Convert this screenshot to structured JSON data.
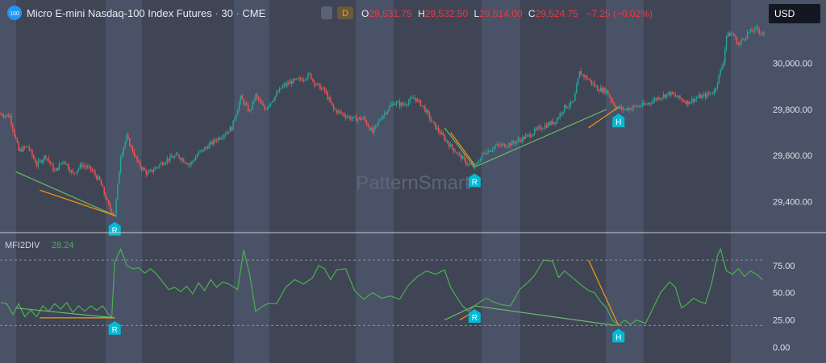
{
  "header": {
    "logo_text": "100",
    "symbol_title": "Micro E-mini Nasdaq-100 Index Futures",
    "interval": "30",
    "exchange": "CME",
    "d_badge": "D",
    "ohlc": [
      {
        "label": "O",
        "value": "29,531.75"
      },
      {
        "label": "H",
        "value": "29,532.50"
      },
      {
        "label": "L",
        "value": "29,514.00"
      },
      {
        "label": "C",
        "value": "29,524.75"
      }
    ],
    "change": "−7.25 (−0.02%)",
    "currency": "USD"
  },
  "watermark": "PatternSmart",
  "colors": {
    "up": "#26a69a",
    "down": "#ef5350",
    "indicator": "#4caf50",
    "divergence_orange": "#ff9800",
    "divergence_green": "#66bb6a",
    "marker": "#00bcd4",
    "background": "#495266",
    "session_shade": "#3f4555",
    "red_text": "#f23645",
    "indicator_value": "#4caf50"
  },
  "indicator": {
    "name": "MFI2DIV",
    "value": "28.24",
    "ticks": [
      "75.00",
      "50.00",
      "25.00",
      "0.00"
    ]
  },
  "chart_data": [
    {
      "type": "candlestick",
      "title": "Micro E-mini Nasdaq-100 Index Futures · 30 · CME",
      "y_ticks": [
        29400,
        29600,
        29800,
        30000
      ],
      "y_tick_labels": [
        "29,400.00",
        "29,600.00",
        "29,800.00",
        "30,000.00"
      ],
      "ylim": [
        29290,
        30170
      ],
      "close_path": [
        [
          0,
          29780
        ],
        [
          6,
          29770
        ],
        [
          12,
          29620
        ],
        [
          18,
          29640
        ],
        [
          24,
          29560
        ],
        [
          30,
          29600
        ],
        [
          36,
          29530
        ],
        [
          42,
          29580
        ],
        [
          48,
          29520
        ],
        [
          54,
          29560
        ],
        [
          60,
          29540
        ],
        [
          66,
          29490
        ],
        [
          72,
          29380
        ],
        [
          76,
          29340
        ],
        [
          80,
          29600
        ],
        [
          84,
          29680
        ],
        [
          88,
          29620
        ],
        [
          92,
          29560
        ],
        [
          98,
          29520
        ],
        [
          104,
          29550
        ],
        [
          110,
          29580
        ],
        [
          118,
          29600
        ],
        [
          126,
          29560
        ],
        [
          132,
          29610
        ],
        [
          140,
          29650
        ],
        [
          148,
          29690
        ],
        [
          154,
          29720
        ],
        [
          160,
          29850
        ],
        [
          166,
          29790
        ],
        [
          170,
          29860
        ],
        [
          176,
          29800
        ],
        [
          182,
          29850
        ],
        [
          188,
          29900
        ],
        [
          194,
          29920
        ],
        [
          200,
          29930
        ],
        [
          206,
          29950
        ],
        [
          210,
          29910
        ],
        [
          216,
          29880
        ],
        [
          222,
          29800
        ],
        [
          228,
          29780
        ],
        [
          234,
          29760
        ],
        [
          242,
          29760
        ],
        [
          248,
          29700
        ],
        [
          254,
          29770
        ],
        [
          262,
          29830
        ],
        [
          268,
          29820
        ],
        [
          276,
          29850
        ],
        [
          282,
          29810
        ],
        [
          288,
          29740
        ],
        [
          294,
          29690
        ],
        [
          300,
          29640
        ],
        [
          306,
          29600
        ],
        [
          312,
          29560
        ],
        [
          316,
          29550
        ],
        [
          322,
          29610
        ],
        [
          330,
          29640
        ],
        [
          340,
          29650
        ],
        [
          350,
          29680
        ],
        [
          360,
          29720
        ],
        [
          370,
          29750
        ],
        [
          376,
          29810
        ],
        [
          382,
          29830
        ],
        [
          386,
          29960
        ],
        [
          392,
          29930
        ],
        [
          398,
          29890
        ],
        [
          404,
          29880
        ],
        [
          410,
          29810
        ],
        [
          416,
          29800
        ],
        [
          422,
          29810
        ],
        [
          430,
          29820
        ],
        [
          438,
          29850
        ],
        [
          446,
          29870
        ],
        [
          452,
          29850
        ],
        [
          458,
          29830
        ],
        [
          464,
          29850
        ],
        [
          470,
          29860
        ],
        [
          476,
          29880
        ],
        [
          482,
          30010
        ],
        [
          484,
          30120
        ],
        [
          488,
          30130
        ],
        [
          492,
          30080
        ],
        [
          498,
          30130
        ],
        [
          504,
          30150
        ],
        [
          508,
          30130
        ]
      ],
      "annotations": [
        {
          "label": "R",
          "x_index": 76,
          "value": 29340
        },
        {
          "label": "R",
          "x_index": 316,
          "value": 29550
        },
        {
          "label": "H",
          "x_index": 412,
          "value": 29810
        }
      ]
    },
    {
      "type": "line",
      "series": [
        {
          "name": "MFI2DIV",
          "values": [
            [
              0,
              41
            ],
            [
              4,
              40
            ],
            [
              8,
              30
            ],
            [
              12,
              40
            ],
            [
              16,
              28
            ],
            [
              20,
              34
            ],
            [
              24,
              28
            ],
            [
              28,
              38
            ],
            [
              32,
              33
            ],
            [
              36,
              40
            ],
            [
              40,
              35
            ],
            [
              44,
              41
            ],
            [
              48,
              32
            ],
            [
              52,
              38
            ],
            [
              56,
              33
            ],
            [
              60,
              38
            ],
            [
              64,
              34
            ],
            [
              68,
              38
            ],
            [
              72,
              30
            ],
            [
              74,
              27
            ],
            [
              76,
              78
            ],
            [
              80,
              90
            ],
            [
              84,
              75
            ],
            [
              88,
              72
            ],
            [
              92,
              73
            ],
            [
              96,
              68
            ],
            [
              100,
              72
            ],
            [
              104,
              67
            ],
            [
              108,
              60
            ],
            [
              112,
              53
            ],
            [
              116,
              55
            ],
            [
              120,
              51
            ],
            [
              124,
              56
            ],
            [
              128,
              49
            ],
            [
              132,
              59
            ],
            [
              136,
              52
            ],
            [
              140,
              62
            ],
            [
              144,
              55
            ],
            [
              148,
              60
            ],
            [
              152,
              58
            ],
            [
              158,
              53
            ],
            [
              162,
              89
            ],
            [
              166,
              67
            ],
            [
              170,
              33
            ],
            [
              174,
              37
            ],
            [
              178,
              40
            ],
            [
              184,
              40
            ],
            [
              190,
              55
            ],
            [
              196,
              62
            ],
            [
              202,
              58
            ],
            [
              208,
              64
            ],
            [
              212,
              75
            ],
            [
              216,
              72
            ],
            [
              220,
              62
            ],
            [
              224,
              71
            ],
            [
              230,
              72
            ],
            [
              236,
              52
            ],
            [
              242,
              44
            ],
            [
              248,
              50
            ],
            [
              254,
              45
            ],
            [
              260,
              47
            ],
            [
              266,
              44
            ],
            [
              272,
              57
            ],
            [
              278,
              65
            ],
            [
              284,
              70
            ],
            [
              290,
              67
            ],
            [
              296,
              71
            ],
            [
              300,
              55
            ],
            [
              304,
              46
            ],
            [
              308,
              38
            ],
            [
              312,
              33
            ],
            [
              316,
              38
            ],
            [
              320,
              42
            ],
            [
              324,
              45
            ],
            [
              328,
              42
            ],
            [
              334,
              39
            ],
            [
              340,
              38
            ],
            [
              346,
              53
            ],
            [
              352,
              60
            ],
            [
              356,
              66
            ],
            [
              362,
              80
            ],
            [
              368,
              79
            ],
            [
              372,
              64
            ],
            [
              376,
              70
            ],
            [
              382,
              63
            ],
            [
              388,
              56
            ],
            [
              392,
              52
            ],
            [
              396,
              50
            ],
            [
              400,
              42
            ],
            [
              404,
              36
            ],
            [
              408,
              25
            ],
            [
              412,
              20
            ],
            [
              416,
              25
            ],
            [
              420,
              21
            ],
            [
              424,
              25
            ],
            [
              430,
              22
            ],
            [
              434,
              33
            ],
            [
              440,
              50
            ],
            [
              446,
              60
            ],
            [
              450,
              55
            ],
            [
              454,
              36
            ],
            [
              458,
              40
            ],
            [
              462,
              45
            ],
            [
              466,
              42
            ],
            [
              470,
              40
            ],
            [
              474,
              58
            ],
            [
              478,
              84
            ],
            [
              480,
              90
            ],
            [
              484,
              70
            ],
            [
              488,
              67
            ],
            [
              492,
              72
            ],
            [
              496,
              65
            ],
            [
              500,
              70
            ],
            [
              504,
              67
            ],
            [
              508,
              62
            ]
          ]
        }
      ],
      "y_ticks": [
        75,
        50,
        25,
        0
      ],
      "y_tick_labels": [
        "75.00",
        "50.00",
        "25.00",
        "0.00"
      ],
      "ylim": [
        -10,
        100
      ],
      "reference_lines": [
        80,
        20
      ],
      "annotations": [
        {
          "label": "R",
          "x_index": 76,
          "value": 27
        },
        {
          "label": "R",
          "x_index": 316,
          "value": 38
        },
        {
          "label": "H",
          "x_index": 412,
          "value": 20
        }
      ]
    }
  ]
}
